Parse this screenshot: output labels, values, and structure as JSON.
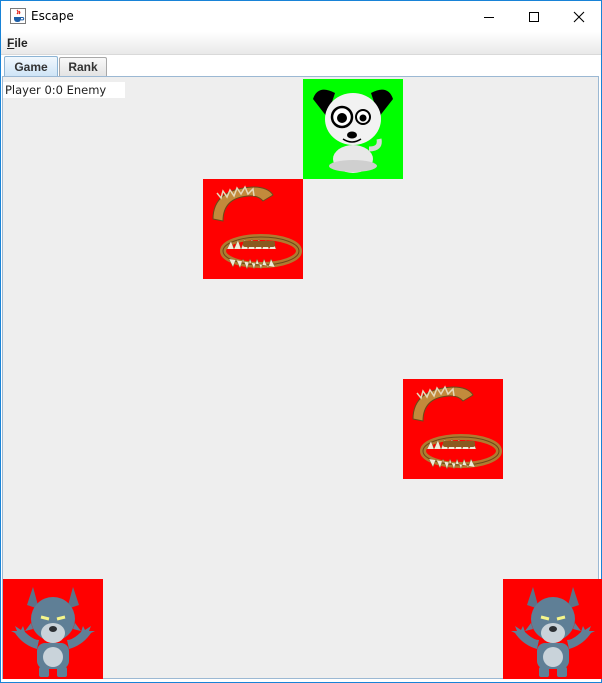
{
  "window": {
    "title": "Escape",
    "icon": "java-cup-icon"
  },
  "menu": {
    "file_label": "File"
  },
  "tabs": [
    {
      "label": "Game",
      "selected": true
    },
    {
      "label": "Rank",
      "selected": false
    }
  ],
  "score": {
    "text": "Player 0:0 Enemy"
  },
  "board": {
    "grid_size": 6,
    "colors": {
      "player_bg": "#00ff00",
      "hazard_bg": "#ff0000",
      "board_bg": "#eeeeee"
    },
    "pieces": [
      {
        "type": "player",
        "icon": "dog-icon",
        "row": 0,
        "col": 3
      },
      {
        "type": "trap",
        "icon": "bear-trap-icon",
        "row": 1,
        "col": 2
      },
      {
        "type": "trap",
        "icon": "bear-trap-icon",
        "row": 3,
        "col": 4
      },
      {
        "type": "enemy",
        "icon": "werewolf-icon",
        "row": 5,
        "col": 0
      },
      {
        "type": "enemy",
        "icon": "werewolf-icon",
        "row": 5,
        "col": 5
      }
    ]
  }
}
